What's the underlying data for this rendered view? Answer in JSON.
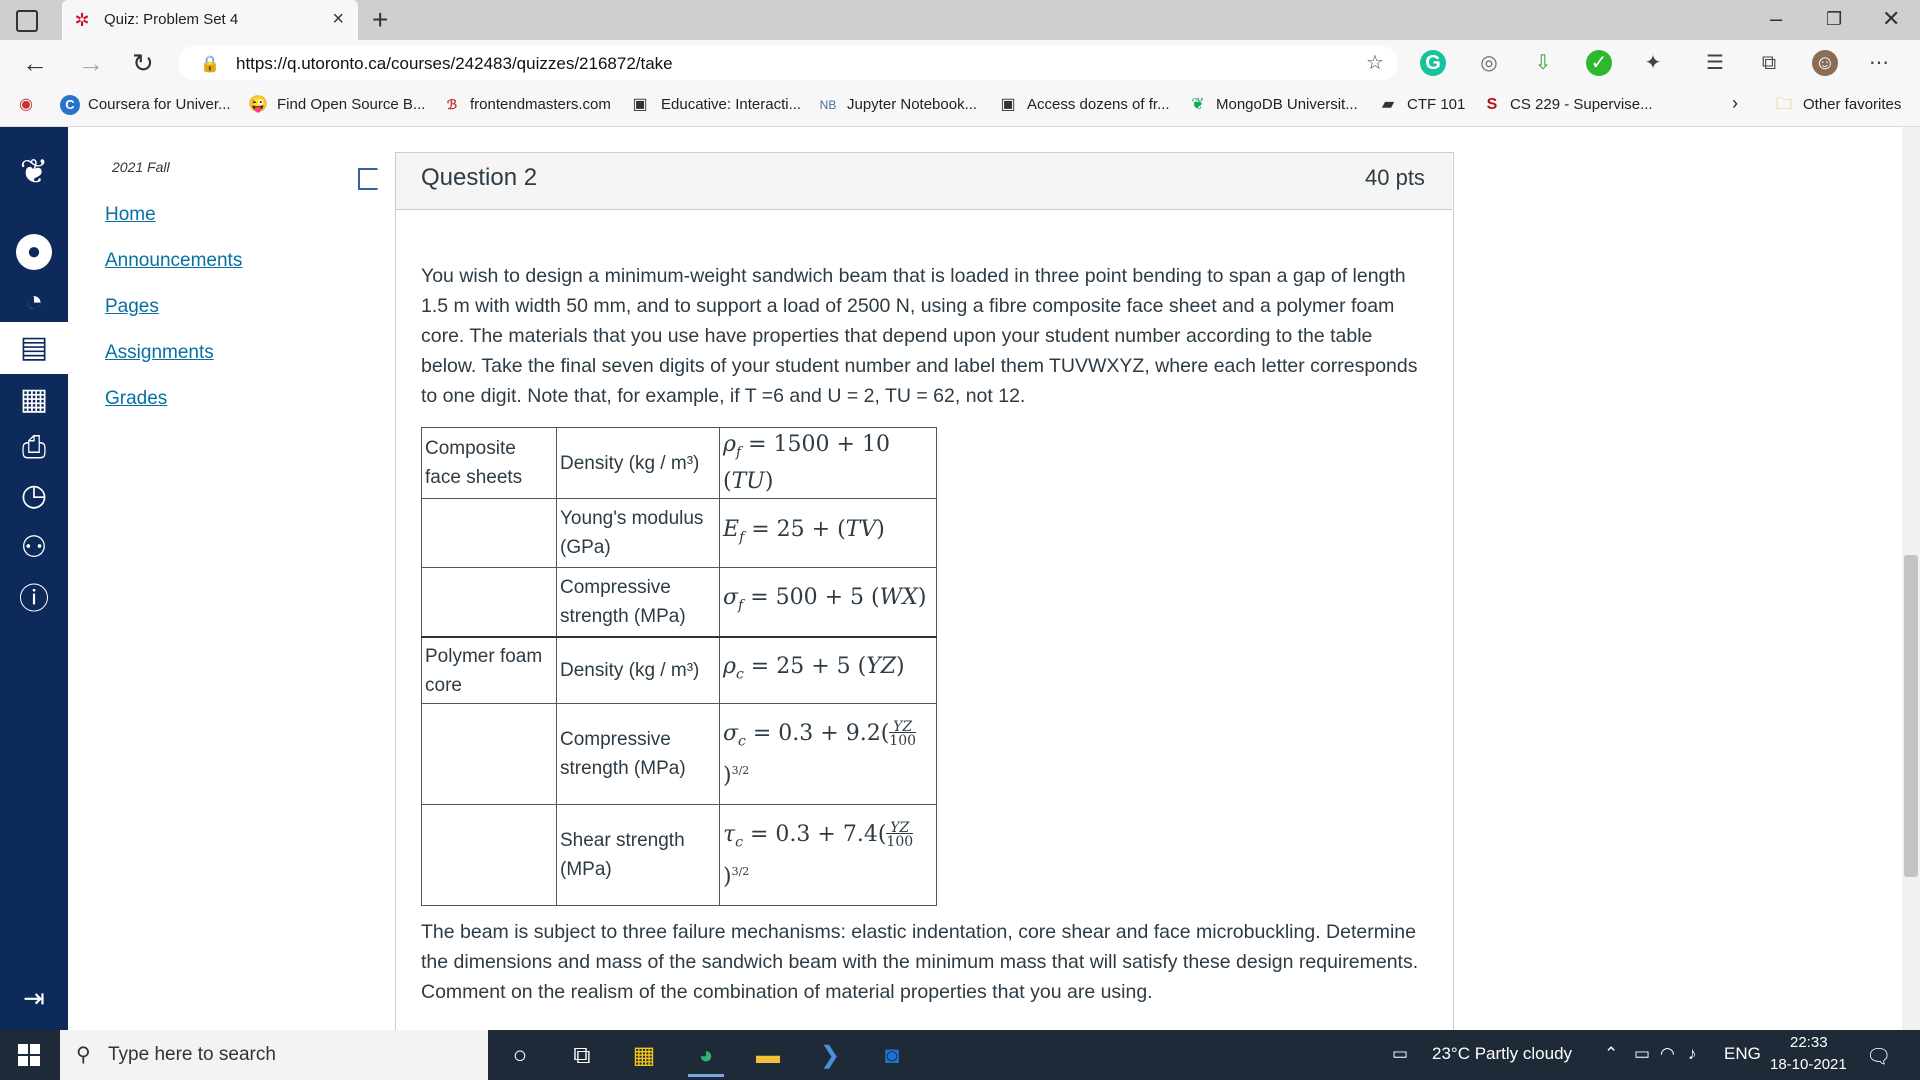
{
  "browser": {
    "tab_title": "Quiz: Problem Set 4",
    "url": "https://q.utoronto.ca/courses/242483/quizzes/216872/take",
    "bookmarks": [
      "Coursera for Univer...",
      "Find Open Source B...",
      "frontendmasters.com",
      "Educative: Interacti...",
      "Jupyter Notebook...",
      "Access dozens of fr...",
      "MongoDB Universit...",
      "CTF 101",
      "CS 229 - Supervise..."
    ],
    "other_favorites": "Other favorites"
  },
  "course_nav": {
    "term": "2021 Fall",
    "links": [
      "Home",
      "Announcements",
      "Pages",
      "Assignments",
      "Grades"
    ]
  },
  "question": {
    "title": "Question 2",
    "points": "40 pts",
    "intro": "You wish to design a minimum-weight sandwich beam that is loaded in three point bending to span a gap of length 1.5 m with width 50 mm, and to support a load of 2500 N, using a fibre composite face sheet and a polymer foam core. The materials that you use have properties that depend upon your student number according to the table below. Take the final seven digits of your student number and label them TUVWXYZ, where each letter corresponds to one digit. Note that, for example, if T =6 and U = 2, TU = 62, not 12.",
    "table": [
      {
        "group": "Composite face sheets",
        "property": "Density (kg / m³)",
        "formula": "ρf = 1500 + 10 (TU)"
      },
      {
        "group": "",
        "property": "Young's modulus (GPa)",
        "formula": "Ef = 25 + (TV)"
      },
      {
        "group": "",
        "property": "Compressive strength (MPa)",
        "formula": "σf = 500 + 5 (WX)"
      },
      {
        "group": "Polymer foam core",
        "property": "Density (kg / m³)",
        "formula": "ρc = 25 + 5 (YZ)"
      },
      {
        "group": "",
        "property": "Compressive strength (MPa)",
        "formula": "σc = 0.3 + 9.2(YZ/100)^(3/2)"
      },
      {
        "group": "",
        "property": "Shear strength (MPa)",
        "formula": "τc = 0.3 + 7.4(YZ/100)^(3/2)"
      }
    ],
    "outro": "The beam is subject to three failure mechanisms: elastic indentation, core shear and face microbuckling. Determine the dimensions and mass of the sandwich beam with the minimum mass that will satisfy these design requirements. Comment on the realism of the combination of material properties that you are using."
  },
  "taskbar": {
    "search_placeholder": "Type here to search",
    "weather": "23°C  Partly cloudy",
    "language": "ENG",
    "time": "22:33",
    "date": "18-10-2021"
  }
}
